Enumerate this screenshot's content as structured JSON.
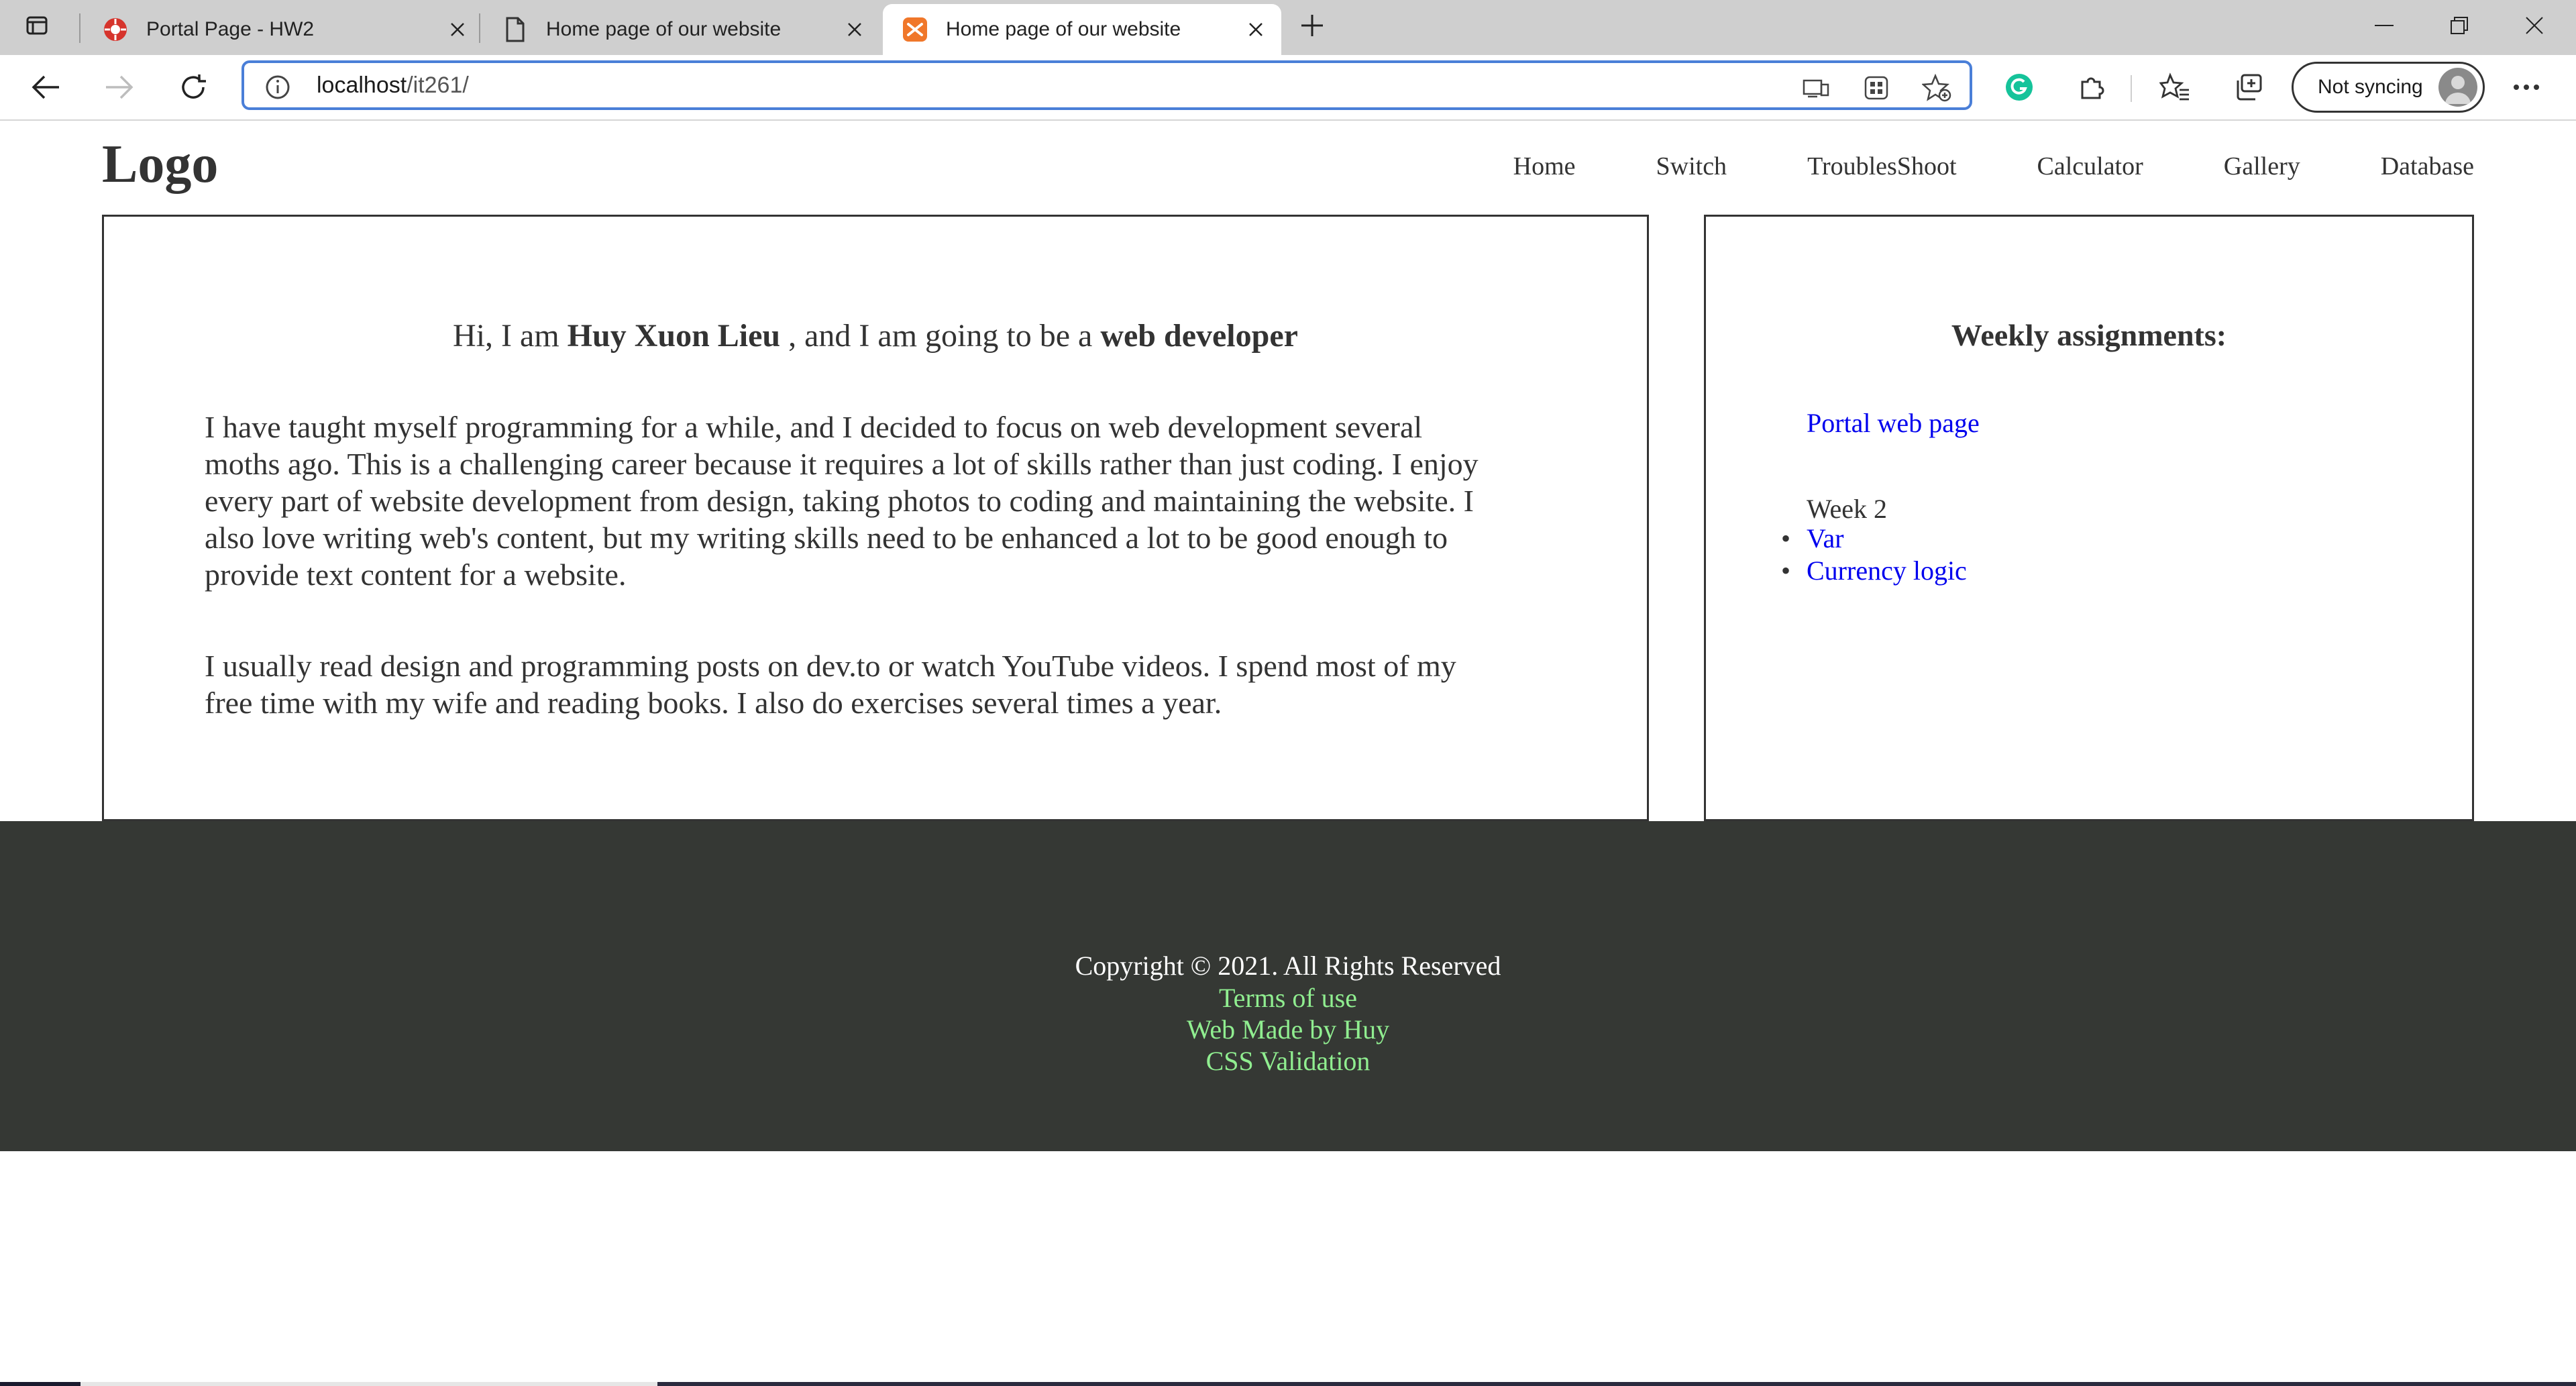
{
  "browser": {
    "tabs": [
      {
        "title": "Portal Page - HW2",
        "icon": "portal-icon",
        "active": false
      },
      {
        "title": "Home page of our website",
        "icon": "page-icon",
        "active": false
      },
      {
        "title": "Home page of our website",
        "icon": "xampp-icon",
        "active": true
      }
    ],
    "address": {
      "host": "localhost",
      "path": "/it261/"
    },
    "sync_label": "Not syncing"
  },
  "site": {
    "logo": "Logo",
    "nav": [
      "Home",
      "Switch",
      "TroublesShoot",
      "Calculator",
      "Gallery",
      "Database"
    ],
    "intro": {
      "prefix": "Hi, I am ",
      "name": "Huy Xuon Lieu",
      "middle": " , and I am going to be a ",
      "role": "web developer"
    },
    "paragraph1": [
      "I have taught myself programming for a while, and I decided to focus on web development several",
      "moths ago. This is a challenging career because it requires a lot of skills rather than just coding. I enjoy",
      "every part of website development from design, taking photos to coding and maintaining the website. I",
      "also love writing web's content, but my writing skills need to be enhanced a lot to be good enough to",
      "provide text content for a website."
    ],
    "paragraph2": [
      "I usually read design and programming posts on dev.to or watch YouTube videos. I spend most of my",
      "free time with my wife and reading books. I also do exercises several times a year."
    ],
    "sidebar": {
      "title": "Weekly assignments:",
      "portal_link": "Portal web page",
      "week_label": "Week 2",
      "items": [
        "Var",
        "Currency logic"
      ]
    },
    "footer": {
      "copyright": "Copyright © 2021. All Rights Reserved",
      "links": [
        "Terms of use",
        "Web Made by Huy",
        "CSS Validation"
      ]
    },
    "colors": {
      "text": "#333333",
      "link": "#0000ee",
      "footer_bg": "#353834",
      "footer_link": "#90ee90"
    }
  }
}
